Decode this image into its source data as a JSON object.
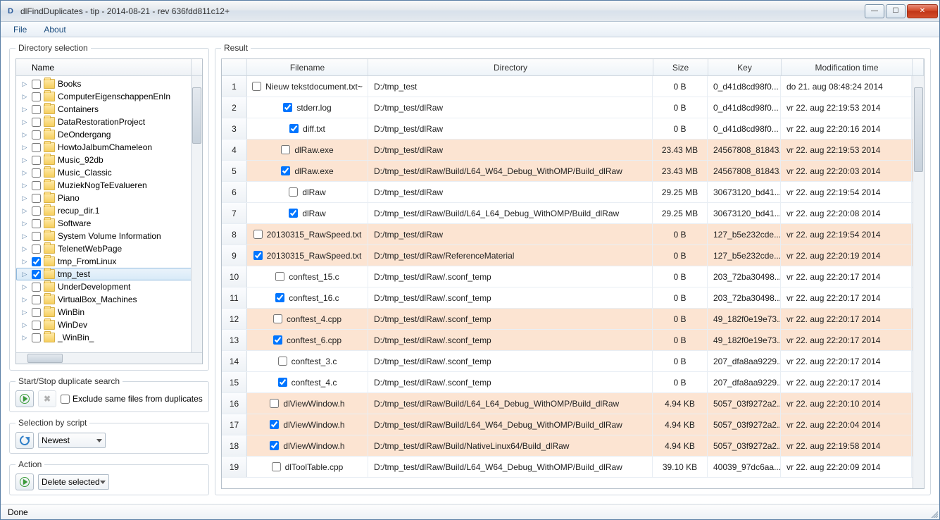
{
  "window": {
    "title": "dlFindDuplicates - tip - 2014-08-21 - rev 636fdd811c12+"
  },
  "menu": {
    "file": "File",
    "about": "About"
  },
  "left": {
    "group_label": "Directory selection",
    "header": "Name",
    "items": [
      {
        "name": "Books",
        "checked": false,
        "selected": false
      },
      {
        "name": "ComputerEigenschappenEnIn",
        "checked": false,
        "selected": false
      },
      {
        "name": "Containers",
        "checked": false,
        "selected": false
      },
      {
        "name": "DataRestorationProject",
        "checked": false,
        "selected": false
      },
      {
        "name": "DeOndergang",
        "checked": false,
        "selected": false
      },
      {
        "name": "HowtoJalbumChameleon",
        "checked": false,
        "selected": false
      },
      {
        "name": "Music_92db",
        "checked": false,
        "selected": false
      },
      {
        "name": "Music_Classic",
        "checked": false,
        "selected": false
      },
      {
        "name": "MuziekNogTeEvalueren",
        "checked": false,
        "selected": false
      },
      {
        "name": "Piano",
        "checked": false,
        "selected": false
      },
      {
        "name": "recup_dir.1",
        "checked": false,
        "selected": false
      },
      {
        "name": "Software",
        "checked": false,
        "selected": false
      },
      {
        "name": "System Volume Information",
        "checked": false,
        "selected": false
      },
      {
        "name": "TelenetWebPage",
        "checked": false,
        "selected": false
      },
      {
        "name": "tmp_FromLinux",
        "checked": true,
        "selected": false
      },
      {
        "name": "tmp_test",
        "checked": true,
        "selected": true
      },
      {
        "name": "UnderDevelopment",
        "checked": false,
        "selected": false
      },
      {
        "name": "VirtualBox_Machines",
        "checked": false,
        "selected": false
      },
      {
        "name": "WinBin",
        "checked": false,
        "selected": false
      },
      {
        "name": "WinDev",
        "checked": false,
        "selected": false
      },
      {
        "name": "_WinBin_",
        "checked": false,
        "selected": false
      }
    ],
    "search_label": "Start/Stop duplicate search",
    "exclude_label": "Exclude same files from duplicates",
    "script_label": "Selection by script",
    "script_combo": "Newest",
    "action_label": "Action",
    "action_combo": "Delete selected"
  },
  "result": {
    "group_label": "Result",
    "headers": {
      "filename": "Filename",
      "directory": "Directory",
      "size": "Size",
      "key": "Key",
      "modification": "Modification time"
    },
    "rows": [
      {
        "n": "1",
        "chk": false,
        "hl": false,
        "fn": "Nieuw tekstdocument.txt~",
        "dir": "D:/tmp_test",
        "size": "0 B",
        "key": "0_d41d8cd98f0...",
        "mod": "do 21. aug 08:48:24 2014"
      },
      {
        "n": "2",
        "chk": true,
        "hl": false,
        "fn": "stderr.log",
        "dir": "D:/tmp_test/dlRaw",
        "size": "0 B",
        "key": "0_d41d8cd98f0...",
        "mod": "vr 22. aug 22:19:53 2014"
      },
      {
        "n": "3",
        "chk": true,
        "hl": false,
        "fn": "diff.txt",
        "dir": "D:/tmp_test/dlRaw",
        "size": "0 B",
        "key": "0_d41d8cd98f0...",
        "mod": "vr 22. aug 22:20:16 2014"
      },
      {
        "n": "4",
        "chk": false,
        "hl": true,
        "fn": "dlRaw.exe",
        "dir": "D:/tmp_test/dlRaw",
        "size": "23.43 MB",
        "key": "24567808_81843...",
        "mod": "vr 22. aug 22:19:53 2014"
      },
      {
        "n": "5",
        "chk": true,
        "hl": true,
        "fn": "dlRaw.exe",
        "dir": "D:/tmp_test/dlRaw/Build/L64_W64_Debug_WithOMP/Build_dlRaw",
        "size": "23.43 MB",
        "key": "24567808_81843...",
        "mod": "vr 22. aug 22:20:03 2014"
      },
      {
        "n": "6",
        "chk": false,
        "hl": false,
        "fn": "dlRaw",
        "dir": "D:/tmp_test/dlRaw",
        "size": "29.25 MB",
        "key": "30673120_bd41...",
        "mod": "vr 22. aug 22:19:54 2014"
      },
      {
        "n": "7",
        "chk": true,
        "hl": false,
        "fn": "dlRaw",
        "dir": "D:/tmp_test/dlRaw/Build/L64_L64_Debug_WithOMP/Build_dlRaw",
        "size": "29.25 MB",
        "key": "30673120_bd41...",
        "mod": "vr 22. aug 22:20:08 2014"
      },
      {
        "n": "8",
        "chk": false,
        "hl": true,
        "fn": "20130315_RawSpeed.txt",
        "dir": "D:/tmp_test/dlRaw",
        "size": "0 B",
        "key": "127_b5e232cde...",
        "mod": "vr 22. aug 22:19:54 2014"
      },
      {
        "n": "9",
        "chk": true,
        "hl": true,
        "fn": "20130315_RawSpeed.txt",
        "dir": "D:/tmp_test/dlRaw/ReferenceMaterial",
        "size": "0 B",
        "key": "127_b5e232cde...",
        "mod": "vr 22. aug 22:20:19 2014"
      },
      {
        "n": "10",
        "chk": false,
        "hl": false,
        "fn": "conftest_15.c",
        "dir": "D:/tmp_test/dlRaw/.sconf_temp",
        "size": "0 B",
        "key": "203_72ba30498...",
        "mod": "vr 22. aug 22:20:17 2014"
      },
      {
        "n": "11",
        "chk": true,
        "hl": false,
        "fn": "conftest_16.c",
        "dir": "D:/tmp_test/dlRaw/.sconf_temp",
        "size": "0 B",
        "key": "203_72ba30498...",
        "mod": "vr 22. aug 22:20:17 2014"
      },
      {
        "n": "12",
        "chk": false,
        "hl": true,
        "fn": "conftest_4.cpp",
        "dir": "D:/tmp_test/dlRaw/.sconf_temp",
        "size": "0 B",
        "key": "49_182f0e19e73...",
        "mod": "vr 22. aug 22:20:17 2014"
      },
      {
        "n": "13",
        "chk": true,
        "hl": true,
        "fn": "conftest_6.cpp",
        "dir": "D:/tmp_test/dlRaw/.sconf_temp",
        "size": "0 B",
        "key": "49_182f0e19e73...",
        "mod": "vr 22. aug 22:20:17 2014"
      },
      {
        "n": "14",
        "chk": false,
        "hl": false,
        "fn": "conftest_3.c",
        "dir": "D:/tmp_test/dlRaw/.sconf_temp",
        "size": "0 B",
        "key": "207_dfa8aa9229...",
        "mod": "vr 22. aug 22:20:17 2014"
      },
      {
        "n": "15",
        "chk": true,
        "hl": false,
        "fn": "conftest_4.c",
        "dir": "D:/tmp_test/dlRaw/.sconf_temp",
        "size": "0 B",
        "key": "207_dfa8aa9229...",
        "mod": "vr 22. aug 22:20:17 2014"
      },
      {
        "n": "16",
        "chk": false,
        "hl": true,
        "fn": "dlViewWindow.h",
        "dir": "D:/tmp_test/dlRaw/Build/L64_L64_Debug_WithOMP/Build_dlRaw",
        "size": "4.94 KB",
        "key": "5057_03f9272a2...",
        "mod": "vr 22. aug 22:20:10 2014"
      },
      {
        "n": "17",
        "chk": true,
        "hl": true,
        "fn": "dlViewWindow.h",
        "dir": "D:/tmp_test/dlRaw/Build/L64_W64_Debug_WithOMP/Build_dlRaw",
        "size": "4.94 KB",
        "key": "5057_03f9272a2...",
        "mod": "vr 22. aug 22:20:04 2014"
      },
      {
        "n": "18",
        "chk": true,
        "hl": true,
        "fn": "dlViewWindow.h",
        "dir": "D:/tmp_test/dlRaw/Build/NativeLinux64/Build_dlRaw",
        "size": "4.94 KB",
        "key": "5057_03f9272a2...",
        "mod": "vr 22. aug 22:19:58 2014"
      },
      {
        "n": "19",
        "chk": false,
        "hl": false,
        "fn": "dlToolTable.cpp",
        "dir": "D:/tmp_test/dlRaw/Build/L64_W64_Debug_WithOMP/Build_dlRaw",
        "size": "39.10 KB",
        "key": "40039_97dc6aa...",
        "mod": "vr 22. aug 22:20:09 2014"
      }
    ]
  },
  "status": "Done"
}
